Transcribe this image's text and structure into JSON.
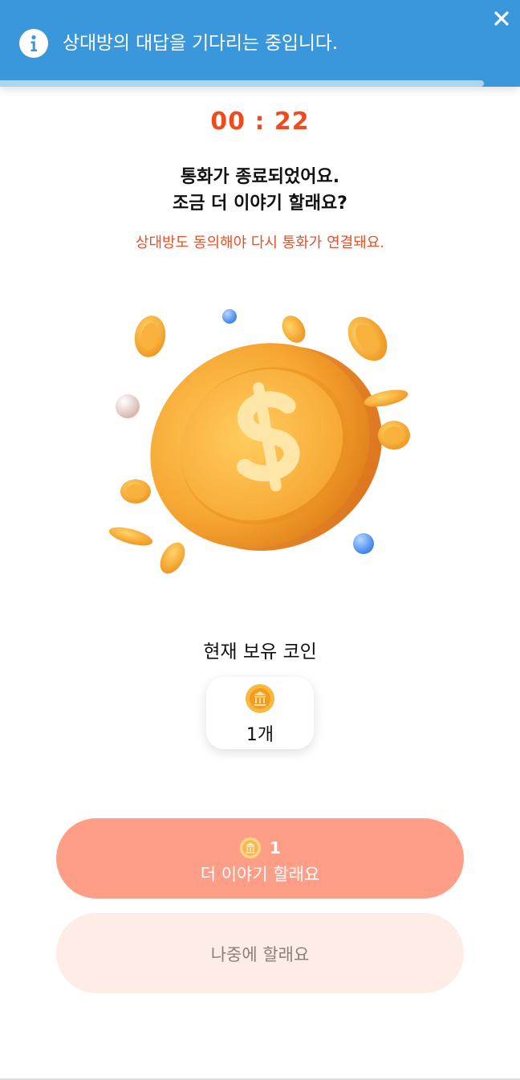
{
  "notification": {
    "message": "상대방의 대답을 기다리는 중입니다.",
    "icon": "info-icon",
    "close_icon": "close-icon",
    "progress_fraction": 0.93,
    "color": "#3a97dc"
  },
  "timer": {
    "text": "00 : 22",
    "color": "#ee4b1e"
  },
  "dialog": {
    "title_line1": "통화가 종료되었어요.",
    "title_line2": "조금 더 이야기 할래요?",
    "subtitle": "상대방도 동의해야 다시 통화가 연결돼요.",
    "illustration": "gold-coin-illustration"
  },
  "balance": {
    "label": "현재 보유 코인",
    "amount": "1개",
    "icon": "coin-icon"
  },
  "actions": {
    "continue": {
      "cost": "1",
      "label": "더 이야기 할래요",
      "color": "#ff9e86"
    },
    "later": {
      "label": "나중에 할래요",
      "color": "#feece6"
    }
  }
}
